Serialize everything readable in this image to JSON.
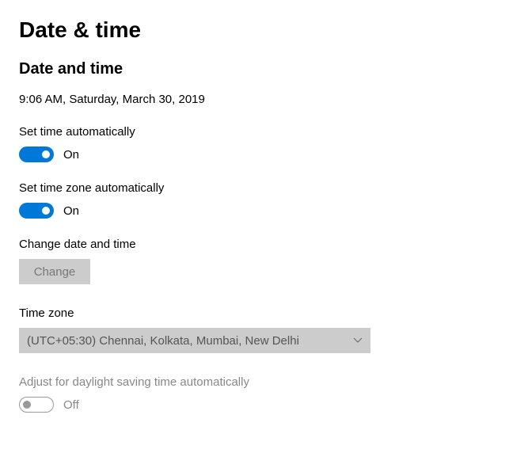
{
  "page": {
    "title": "Date & time"
  },
  "section": {
    "title": "Date and time",
    "current_datetime": "9:06 AM, Saturday, March 30, 2019"
  },
  "set_time_auto": {
    "label": "Set time automatically",
    "state": "On"
  },
  "set_timezone_auto": {
    "label": "Set time zone automatically",
    "state": "On"
  },
  "change_datetime": {
    "label": "Change date and time",
    "button": "Change"
  },
  "timezone": {
    "label": "Time zone",
    "selected": "(UTC+05:30) Chennai, Kolkata, Mumbai, New Delhi"
  },
  "dst": {
    "label": "Adjust for daylight saving time automatically",
    "state": "Off"
  }
}
